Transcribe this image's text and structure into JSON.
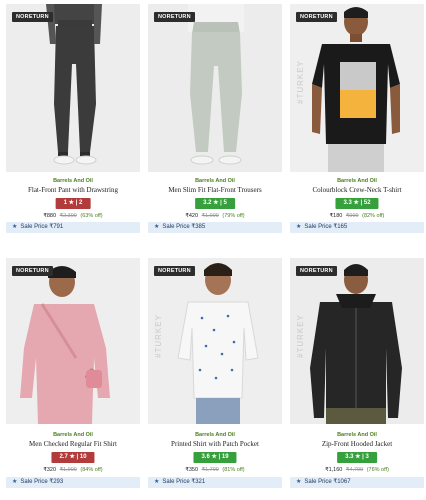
{
  "products": [
    {
      "badge": "NORETURN",
      "brand": "Barrels And Oil",
      "name": "Flat-Front Pant with Drawstring",
      "rating": "1 ★ | 2",
      "rating_color": "#b23b3b",
      "price": "₹880",
      "mrp": "₹2,399",
      "off": "(63% off)",
      "sale": "Sale Price ₹791",
      "vtext": ""
    },
    {
      "badge": "NORETURN",
      "brand": "Barrels And Oil",
      "name": "Men Slim Fit Flat-Front Trousers",
      "rating": "3.2 ★ | 5",
      "rating_color": "#36a03c",
      "price": "₹420",
      "mrp": "₹1,999",
      "off": "(79% off)",
      "sale": "Sale Price ₹385",
      "vtext": ""
    },
    {
      "badge": "NORETURN",
      "brand": "Barrels And Oil",
      "name": "Colourblock Crew-Neck T-shirt",
      "rating": "3.3 ★ | 52",
      "rating_color": "#36a03c",
      "price": "₹180",
      "mrp": "₹999",
      "off": "(82% off)",
      "sale": "Sale Price ₹165",
      "vtext": "#TURKEY"
    },
    {
      "badge": "NORETURN",
      "brand": "Barrels And Oil",
      "name": "Men Checked Regular Fit Shirt",
      "rating": "2.7 ★ | 10",
      "rating_color": "#b23b3b",
      "price": "₹320",
      "mrp": "₹1,999",
      "off": "(84% off)",
      "sale": "Sale Price ₹293",
      "vtext": ""
    },
    {
      "badge": "NORETURN",
      "brand": "Barrels And Oil",
      "name": "Printed Shirt with Patch Pocket",
      "rating": "3.6 ★ | 19",
      "rating_color": "#36a03c",
      "price": "₹350",
      "mrp": "₹1,799",
      "off": "(81% off)",
      "sale": "Sale Price ₹321",
      "vtext": "#TURKEY"
    },
    {
      "badge": "NORETURN",
      "brand": "Barrels And Oil",
      "name": "Zip-Front Hooded Jacket",
      "rating": "3.3 ★ | 3",
      "rating_color": "#36a03c",
      "price": "₹1,160",
      "mrp": "₹4,799",
      "off": "(76% off)",
      "sale": "Sale Price ₹1067",
      "vtext": "#TURKEY"
    }
  ],
  "icons": {
    "sale": "star-icon"
  }
}
